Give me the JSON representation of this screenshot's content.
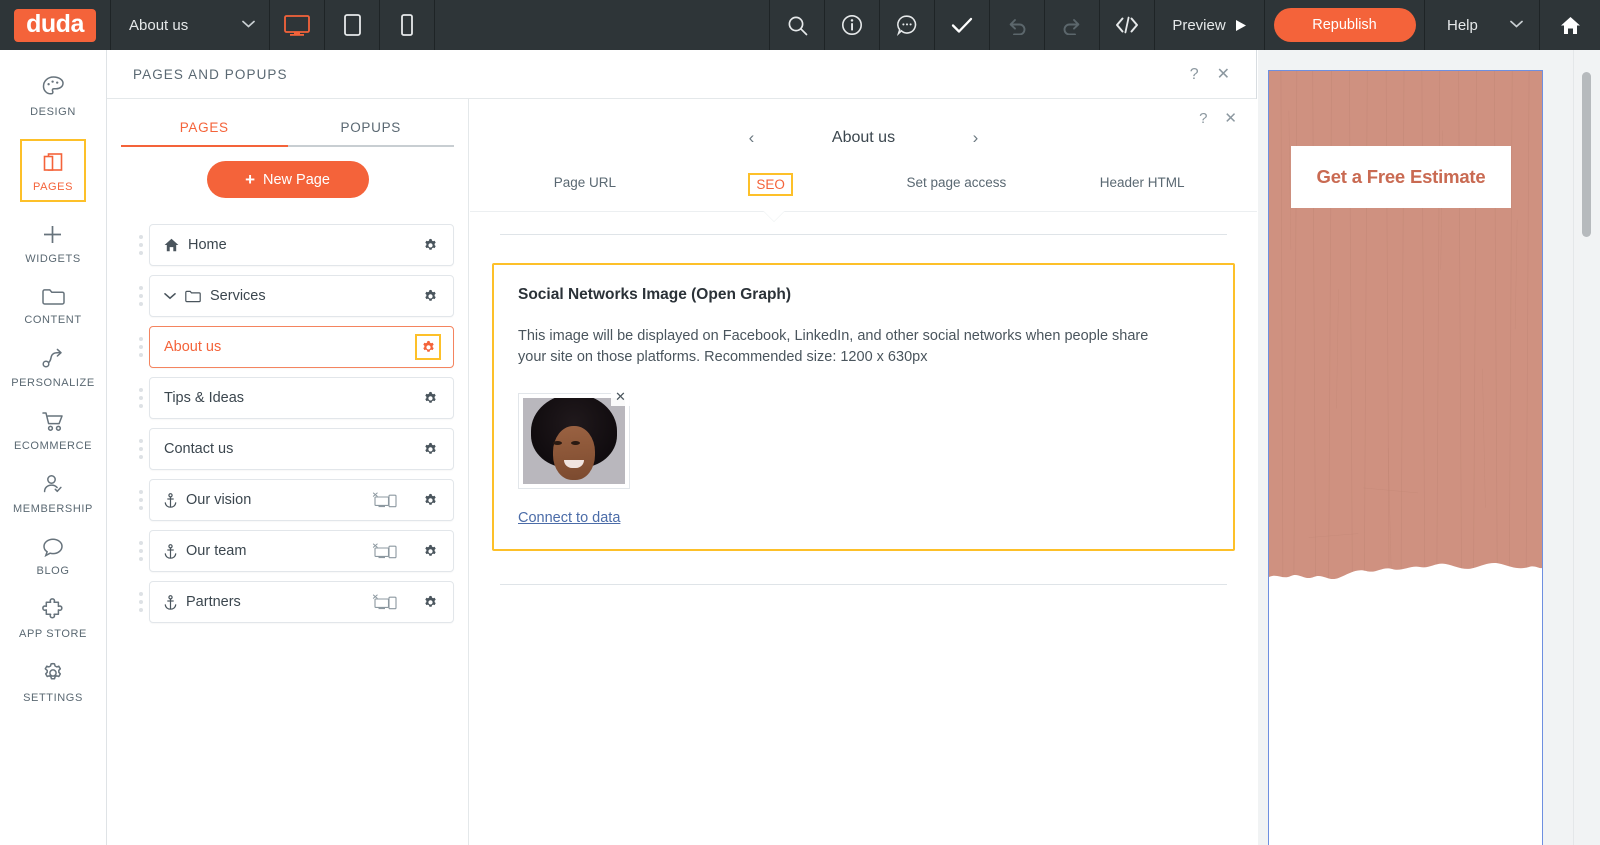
{
  "topbar": {
    "logo_text": "duda",
    "page_selector_value": "About us",
    "device_desktop": "desktop-icon",
    "device_tablet": "tablet-icon",
    "device_mobile": "mobile-icon",
    "icons": [
      "search-icon",
      "info-icon",
      "comment-icon",
      "check-icon",
      "undo-icon",
      "redo-icon",
      "code-icon"
    ],
    "preview_label": "Preview",
    "republish_label": "Republish",
    "help_label": "Help",
    "home_icon": "home-icon",
    "accent_color": "#f4633a",
    "bar_color": "#2e3538"
  },
  "leftnav": {
    "items": [
      {
        "label": "DESIGN",
        "icon": "palette-icon",
        "active": false
      },
      {
        "label": "PAGES",
        "icon": "pages-icon",
        "active": true
      },
      {
        "label": "WIDGETS",
        "icon": "plus-icon",
        "active": false
      },
      {
        "label": "CONTENT",
        "icon": "folder-icon",
        "active": false
      },
      {
        "label": "PERSONALIZE",
        "icon": "path-arrow-icon",
        "active": false
      },
      {
        "label": "ECOMMERCE",
        "icon": "cart-icon",
        "active": false
      },
      {
        "label": "MEMBERSHIP",
        "icon": "user-check-icon",
        "active": false
      },
      {
        "label": "BLOG",
        "icon": "speech-bubble-icon",
        "active": false
      },
      {
        "label": "APP STORE",
        "icon": "puzzle-icon",
        "active": false
      },
      {
        "label": "SETTINGS",
        "icon": "gear-icon",
        "active": false
      }
    ],
    "highlight_color": "#fdc029"
  },
  "panel": {
    "title": "PAGES AND POPUPS",
    "help_glyph": "?",
    "close_glyph": "✕"
  },
  "pages": {
    "tabs": [
      {
        "label": "PAGES",
        "active": true
      },
      {
        "label": "POPUPS",
        "active": false
      }
    ],
    "new_page_label": "New Page",
    "new_page_plus": "+",
    "items": [
      {
        "name": "Home",
        "icon": "home-icon",
        "selected": false,
        "hidden_devices": false
      },
      {
        "name": "Services",
        "icon": "folder-icon",
        "expander": "chevron-down-icon",
        "selected": false,
        "hidden_devices": false
      },
      {
        "name": "About us",
        "icon": "none",
        "selected": true,
        "hidden_devices": false,
        "gear_highlighted": true
      },
      {
        "name": "Tips & Ideas",
        "icon": "none",
        "selected": false,
        "hidden_devices": false
      },
      {
        "name": "Contact us",
        "icon": "none",
        "selected": false,
        "hidden_devices": false
      },
      {
        "name": "Our vision",
        "icon": "anchor-icon",
        "selected": false,
        "hidden_devices": true
      },
      {
        "name": "Our team",
        "icon": "anchor-icon",
        "selected": false,
        "hidden_devices": true
      },
      {
        "name": "Partners",
        "icon": "anchor-icon",
        "selected": false,
        "hidden_devices": true
      }
    ]
  },
  "seo": {
    "help_glyph": "?",
    "close_glyph": "✕",
    "prev_glyph": "‹",
    "next_glyph": "›",
    "page_title": "About us",
    "tabs": [
      {
        "label": "Page URL",
        "active": false
      },
      {
        "label": "SEO",
        "active": true
      },
      {
        "label": "Set page access",
        "active": false
      },
      {
        "label": "Header HTML",
        "active": false
      }
    ],
    "open_graph": {
      "title": "Social Networks Image (Open Graph)",
      "description": "This image will be displayed on Facebook, LinkedIn, and other social networks when people share your site on those platforms. Recommended size: 1200 x 630px",
      "remove_glyph": "✕",
      "thumbnail_alt": "portrait-thumbnail",
      "connect_label": "Connect to data",
      "border_color": "#fdc029"
    }
  },
  "preview": {
    "cta_label": "Get a Free Estimate",
    "hero_color": "#cf9180",
    "cta_text_color": "#c96a52",
    "frame_border_color": "#6e8fe0"
  }
}
